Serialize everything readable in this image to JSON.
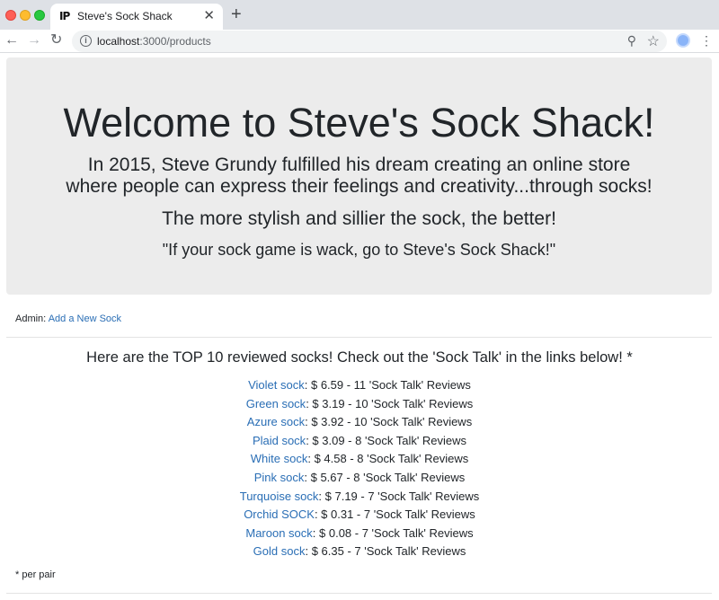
{
  "browser": {
    "tab_title": "Steve's Sock Shack",
    "favicon_text": "IP",
    "url_host": "localhost",
    "url_rest": ":3000/products",
    "icons": {
      "back": "arrow-left-icon",
      "forward": "arrow-right-icon",
      "reload": "reload-icon",
      "info": "info-icon",
      "zoom": "zoom-icon",
      "bookmark": "star-icon",
      "menu": "kebab-menu-icon"
    }
  },
  "hero": {
    "title": "Welcome to Steve's Sock Shack!",
    "intro_line1": "In 2015, Steve Grundy fulfilled his dream creating an online store",
    "intro_line2": "where people can express their feelings and creativity...through socks!",
    "tagline": "The more stylish and sillier the sock, the better!",
    "quote": "\"If your sock game is wack, go to Steve's Sock Shack!\""
  },
  "admin": {
    "label": "Admin:",
    "link": "Add a New Sock"
  },
  "top_heading": "Here are the TOP 10 reviewed socks! Check out the 'Sock Talk' in the links below! *",
  "socks": [
    {
      "name": "Violet sock",
      "detail": ": $ 6.59 - 11 'Sock Talk' Reviews"
    },
    {
      "name": "Green sock",
      "detail": ": $ 3.19 - 10 'Sock Talk' Reviews"
    },
    {
      "name": "Azure sock",
      "detail": ": $ 3.92 - 10 'Sock Talk' Reviews"
    },
    {
      "name": "Plaid sock",
      "detail": ": $ 3.09 - 8 'Sock Talk' Reviews"
    },
    {
      "name": "White sock",
      "detail": ": $ 4.58 - 8 'Sock Talk' Reviews"
    },
    {
      "name": "Pink sock",
      "detail": ": $ 5.67 - 8 'Sock Talk' Reviews"
    },
    {
      "name": "Turquoise sock",
      "detail": ": $ 7.19 - 7 'Sock Talk' Reviews"
    },
    {
      "name": "Orchid SOCK",
      "detail": ": $ 0.31 - 7 'Sock Talk' Reviews"
    },
    {
      "name": "Maroon sock",
      "detail": ": $ 0.08 - 7 'Sock Talk' Reviews"
    },
    {
      "name": "Gold sock",
      "detail": ": $ 6.35 - 7 'Sock Talk' Reviews"
    }
  ],
  "footnote": "* per pair",
  "colors": {
    "link": "#2a6eb5",
    "jumbotron_bg": "#ececec",
    "text": "#212529"
  }
}
